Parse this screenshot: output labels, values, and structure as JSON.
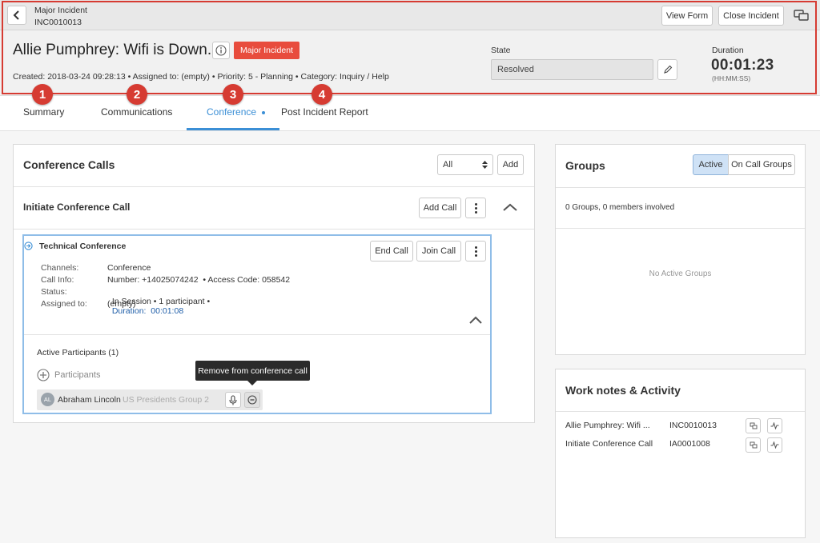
{
  "header": {
    "section": "Major Incident",
    "number": "INC0010013",
    "view_form": "View Form",
    "close_incident": "Close Incident",
    "title": "Allie Pumphrey: Wifi is Down.",
    "major_badge": "Major Incident",
    "created": "Created: 2018-03-24 09:28:13",
    "assigned": "Assigned to: (empty)",
    "priority": "Priority: 5 - Planning",
    "category": "Category: Inquiry / Help",
    "state_label": "State",
    "state_value": "Resolved",
    "duration_label": "Duration",
    "duration_value": "00:01:23",
    "duration_format": "(HH:MM:SS)"
  },
  "callouts": [
    "1",
    "2",
    "3",
    "4"
  ],
  "tabs": [
    {
      "label": "Summary"
    },
    {
      "label": "Communications"
    },
    {
      "label": "Conference",
      "active": true
    },
    {
      "label": "Post Incident Report"
    }
  ],
  "conference": {
    "title": "Conference Calls",
    "filter": "All",
    "add": "Add",
    "initiate": "Initiate Conference Call",
    "add_call": "Add Call",
    "call": {
      "name": "Technical Conference",
      "end_call": "End Call",
      "join_call": "Join Call",
      "channels_label": "Channels:",
      "channels_value": "Conference",
      "callinfo_label": "Call Info:",
      "callinfo_value": "Number: +14025074242  • Access Code: 058542",
      "status_label": "Status:",
      "status_value": "In Session • 1 participant •",
      "status_duration": "Duration:  00:01:08",
      "assigned_label": "Assigned to:",
      "assigned_value": "(empty)",
      "active_participants": "Active Participants (1)",
      "participants": "Participants",
      "participant_initials": "AL",
      "participant_name": "Abraham Lincoln",
      "participant_group": "US Presidents Group 2",
      "tooltip": "Remove from conference call"
    }
  },
  "groups": {
    "title": "Groups",
    "active_btn": "Active",
    "oncall_btn": "On Call Groups",
    "summary": "0 Groups, 0 members involved",
    "empty": "No Active Groups"
  },
  "worknotes": {
    "title": "Work notes & Activity",
    "items": [
      {
        "name": "Allie Pumphrey: Wifi ...",
        "number": "INC0010013"
      },
      {
        "name": "Initiate Conference Call",
        "number": "IA0001008"
      }
    ]
  },
  "colors": {
    "accent": "#3b8fd6",
    "highlight_border": "#d63b32",
    "major_badge": "#e84c3d",
    "link_blue": "#1f5ea8"
  }
}
